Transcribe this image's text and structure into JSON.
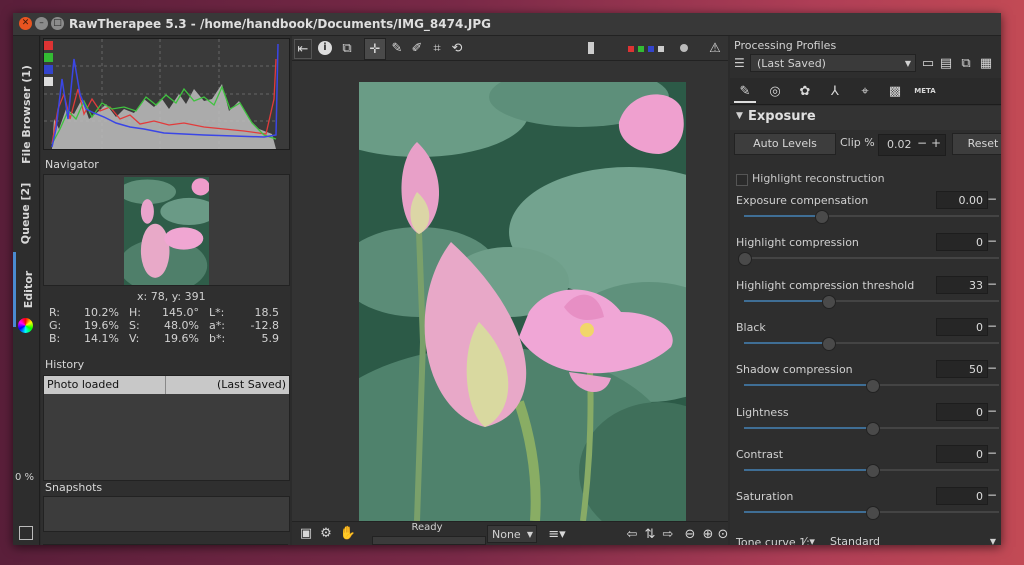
{
  "window": {
    "title": "RawTherapee 5.3 - /home/handbook/Documents/IMG_8474.JPG"
  },
  "sidebar_tabs": {
    "file_browser": "File Browser (1)",
    "queue": "Queue [2]",
    "editor": "Editor",
    "progress": "0 %"
  },
  "navigator": {
    "title": "Navigator",
    "coords": "x: 78, y: 391",
    "readouts": [
      {
        "l": "R:",
        "v": "10.2%"
      },
      {
        "l": "H:",
        "v": "145.0°"
      },
      {
        "l": "L*:",
        "v": "18.5"
      },
      {
        "l": "G:",
        "v": "19.6%"
      },
      {
        "l": "S:",
        "v": "48.0%"
      },
      {
        "l": "a*:",
        "v": "-12.8"
      },
      {
        "l": "B:",
        "v": "14.1%"
      },
      {
        "l": "V:",
        "v": "19.6%"
      },
      {
        "l": "b*:",
        "v": "5.9"
      }
    ]
  },
  "history": {
    "title": "History",
    "entry": "Photo loaded",
    "profile": "(Last Saved)"
  },
  "snapshots": {
    "title": "Snapshots",
    "add": "+",
    "remove": "−"
  },
  "status": {
    "text": "Ready",
    "zoom_select": "None"
  },
  "profiles": {
    "title": "Processing Profiles",
    "selected": "(Last Saved)"
  },
  "exposure": {
    "title": "Exposure",
    "auto_levels": "Auto Levels",
    "clip_label": "Clip %",
    "clip_value": "0.02",
    "reset": "Reset",
    "highlight_reconstruction": "Highlight reconstruction",
    "sliders": [
      {
        "label": "Exposure compensation",
        "value": "0.00",
        "pos": 0.3
      },
      {
        "label": "Highlight compression",
        "value": "0",
        "pos": 0.0
      },
      {
        "label": "Highlight compression threshold",
        "value": "33",
        "pos": 0.33
      },
      {
        "label": "Black",
        "value": "0",
        "pos": 0.33
      },
      {
        "label": "Shadow compression",
        "value": "50",
        "pos": 0.5
      },
      {
        "label": "Lightness",
        "value": "0",
        "pos": 0.5
      },
      {
        "label": "Contrast",
        "value": "0",
        "pos": 0.5
      },
      {
        "label": "Saturation",
        "value": "0",
        "pos": 0.5
      }
    ],
    "tone_curve_label": "Tone curve 1:",
    "tone_curve_value": "Standard"
  },
  "colors": {
    "accent": "#3f6e95",
    "panel": "#2e2e2e",
    "photo_bg": "#3d6b57",
    "lotus": "#e48fbf"
  }
}
